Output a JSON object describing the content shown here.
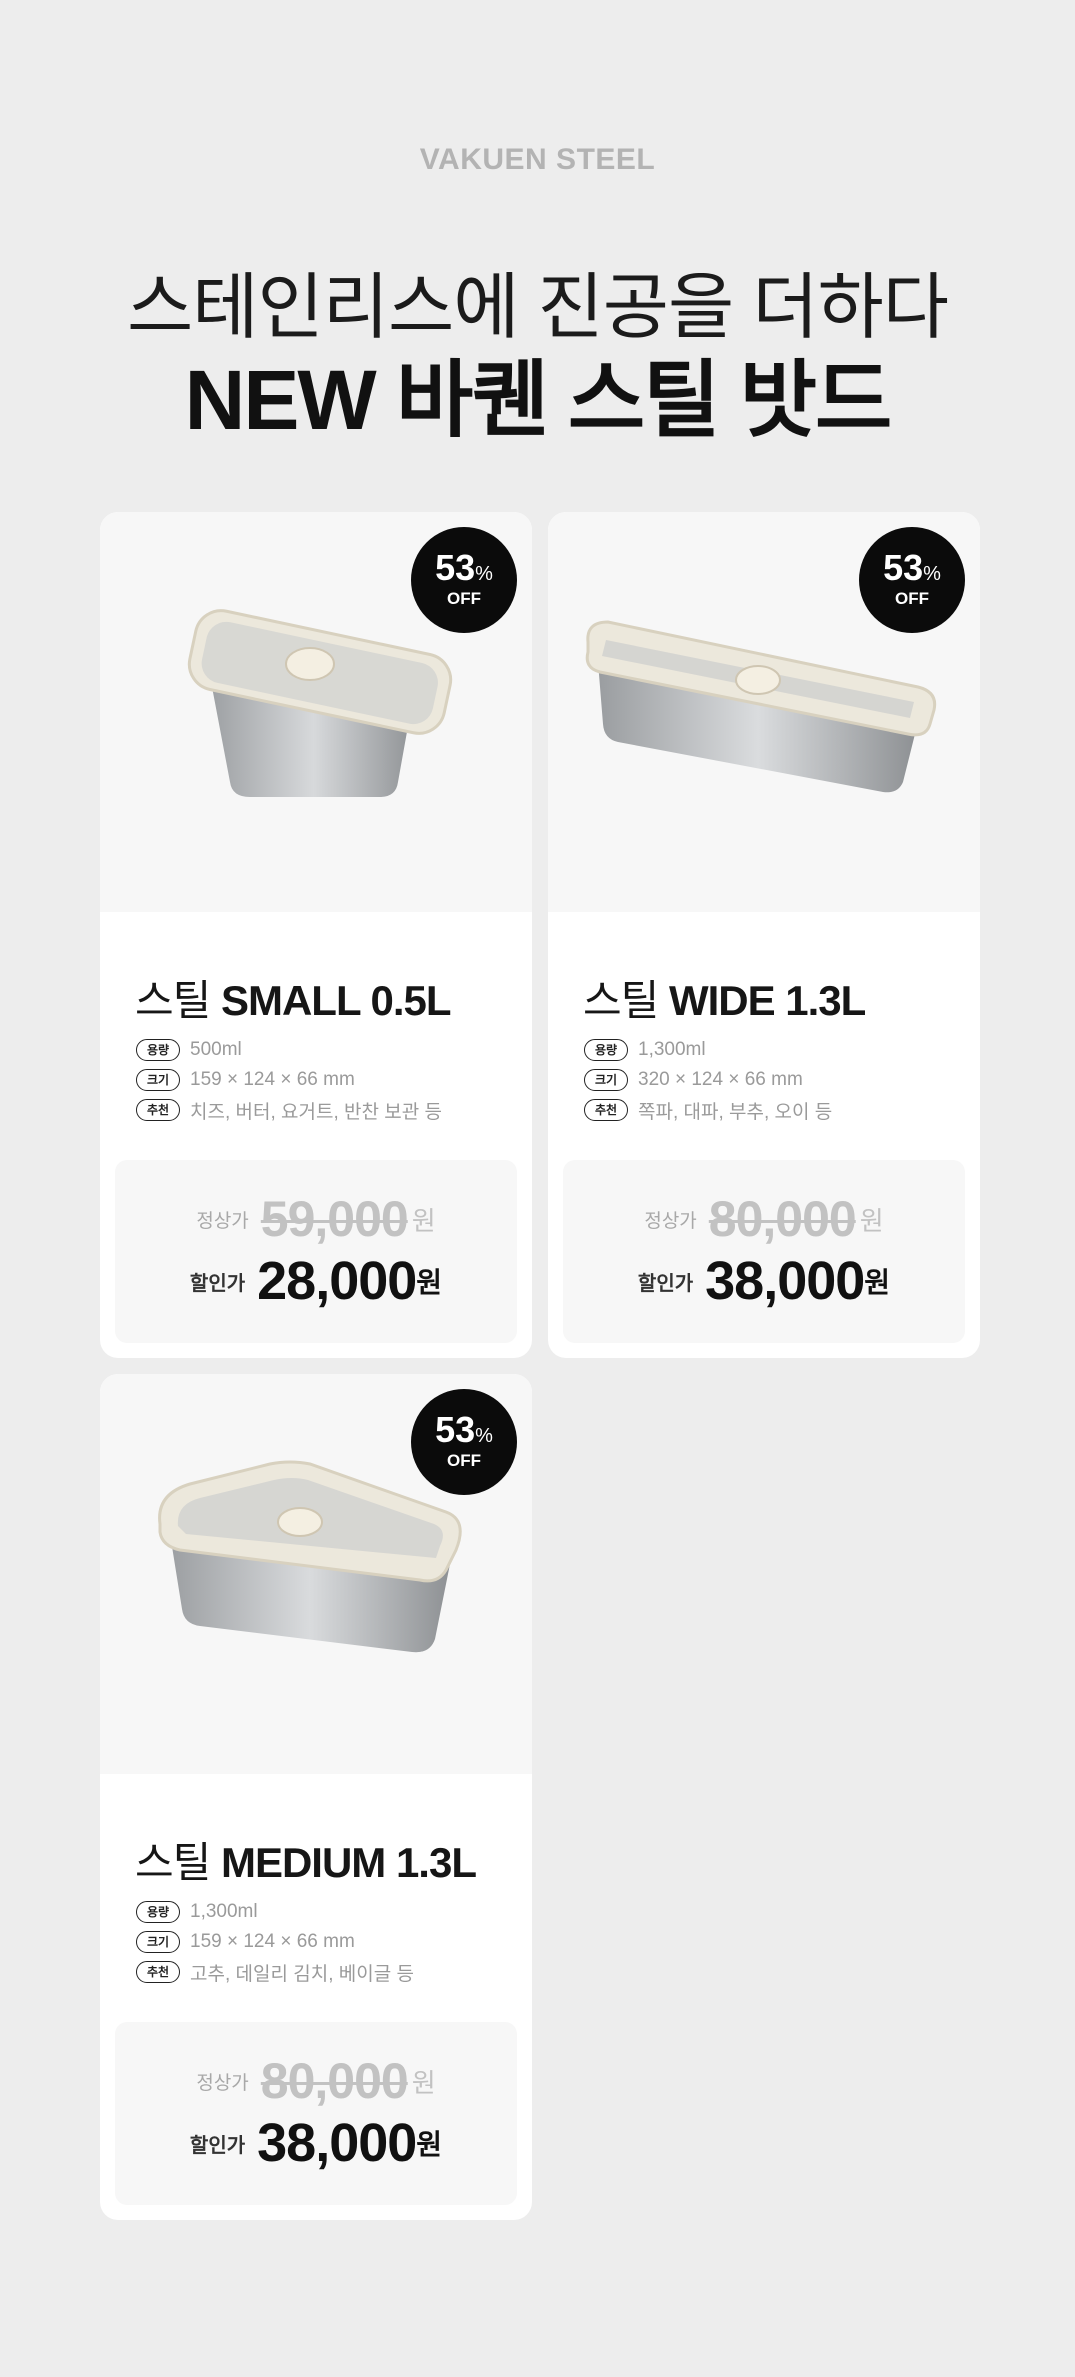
{
  "brand": "VAKUEN STEEL",
  "headline": {
    "line1": "스테인리스에 진공을 더하다",
    "line2": "NEW 바퀜 스틸 밧드"
  },
  "discount": {
    "percent": "53",
    "percent_symbol": "%",
    "off_label": "OFF"
  },
  "spec_labels": {
    "capacity": "용량",
    "size": "크기",
    "recommend": "추천"
  },
  "price_labels": {
    "original": "정상가",
    "sale": "할인가",
    "currency": "원"
  },
  "products": [
    {
      "name_prefix": "스틸",
      "model": "SMALL 0.5L",
      "capacity": "500ml",
      "size": "159 × 124 × 66 mm",
      "recommend": "치즈, 버터, 요거트, 반찬 보관 등",
      "original_price": "59,000",
      "sale_price": "28,000"
    },
    {
      "name_prefix": "스틸",
      "model": "WIDE 1.3L",
      "capacity": "1,300ml",
      "size": "320 × 124 × 66 mm",
      "recommend": "쪽파, 대파, 부추, 오이 등",
      "original_price": "80,000",
      "sale_price": "38,000"
    },
    {
      "name_prefix": "스틸",
      "model": "MEDIUM 1.3L",
      "capacity": "1,300ml",
      "size": "159 × 124 × 66 mm",
      "recommend": "고추, 데일리 김치, 베이글 등",
      "original_price": "80,000",
      "sale_price": "38,000"
    }
  ]
}
